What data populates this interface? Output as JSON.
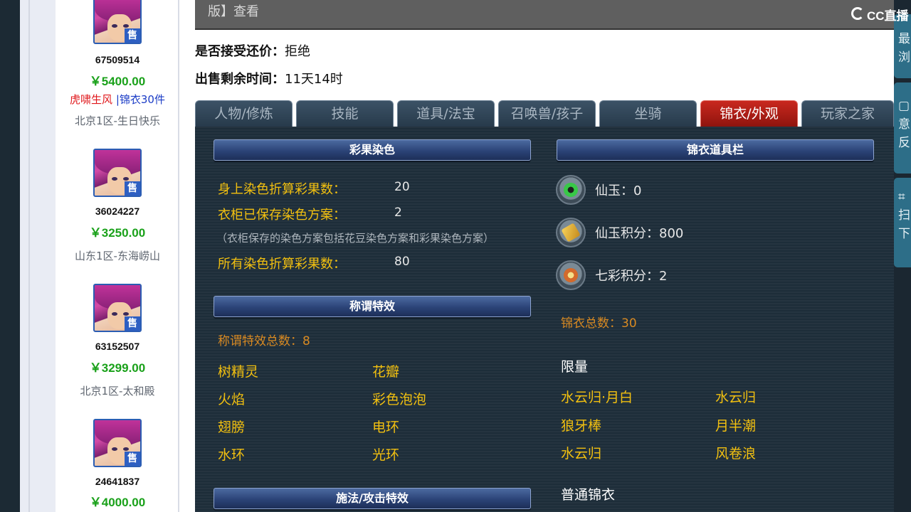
{
  "listings": [
    {
      "id": "67509514",
      "price": "￥5400.00",
      "tag_red": "虎啸生风",
      "tag_sep": " |",
      "tag_blue": "锦衣30件",
      "server": "北京1区-生日快乐",
      "badge": "售"
    },
    {
      "id": "36024227",
      "price": "￥3250.00",
      "server": "山东1区-东海崂山",
      "badge": "售"
    },
    {
      "id": "63152507",
      "price": "￥3299.00",
      "server": "北京1区-太和殿",
      "badge": "售"
    },
    {
      "id": "24641837",
      "price": "￥4000.00",
      "badge": "售"
    }
  ],
  "header": {
    "topbar_text": "版】查看",
    "counter_offer_label": "是否接受还价：",
    "counter_offer_value": "拒绝",
    "time_left_label": "出售剩余时间：",
    "time_left_value": "11天14时"
  },
  "tabs": [
    "人物/修炼",
    "技能",
    "道具/法宝",
    "召唤兽/孩子",
    "坐骑",
    "锦衣/外观",
    "玩家之家"
  ],
  "active_tab": "锦衣/外观",
  "dye": {
    "title": "彩果染色",
    "rows": [
      {
        "label": "身上染色折算彩果数：",
        "value": "20"
      },
      {
        "label": "衣柜已保存染色方案：",
        "value": "2"
      }
    ],
    "note": "（衣柜保存的染色方案包括花豆染色方案和彩果染色方案）",
    "total_label": "所有染色折算彩果数：",
    "total_value": "80"
  },
  "title_effects": {
    "title": "称谓特效",
    "count_text": "称谓特效总数：8",
    "items": [
      "树精灵",
      "花瓣",
      "火焰",
      "彩色泡泡",
      "翅膀",
      "电环",
      "水环",
      "光环"
    ]
  },
  "spell_effects": {
    "title": "施法/攻击特效"
  },
  "wardrobe": {
    "title": "锦衣道具栏",
    "currencies": [
      {
        "icon": "jade-coin-icon",
        "text": "仙玉：0"
      },
      {
        "icon": "jade-points-card-icon",
        "text": "仙玉积分：800"
      },
      {
        "icon": "rainbow-points-icon",
        "text": "七彩积分：2"
      }
    ],
    "total_text": "锦衣总数：30",
    "limited_label": "限量",
    "limited_items": [
      "水云归·月白",
      "水云归",
      "狼牙棒",
      "月半潮",
      "水云归",
      "风卷浪"
    ],
    "normal_label": "普通锦衣"
  },
  "watermark": {
    "small": "CC直播",
    "big": "CC直播"
  },
  "side_widget": {
    "top": [
      "最",
      "浏"
    ],
    "middle": [
      "意",
      "反"
    ],
    "bottom": [
      "扫",
      "下"
    ]
  },
  "colors": {
    "panel_bg": "#1d2d39",
    "active_tab": "#c9281e",
    "yellow_text": "#f2c010",
    "orange_text": "#d98a22",
    "price_green": "#1aa11a"
  }
}
